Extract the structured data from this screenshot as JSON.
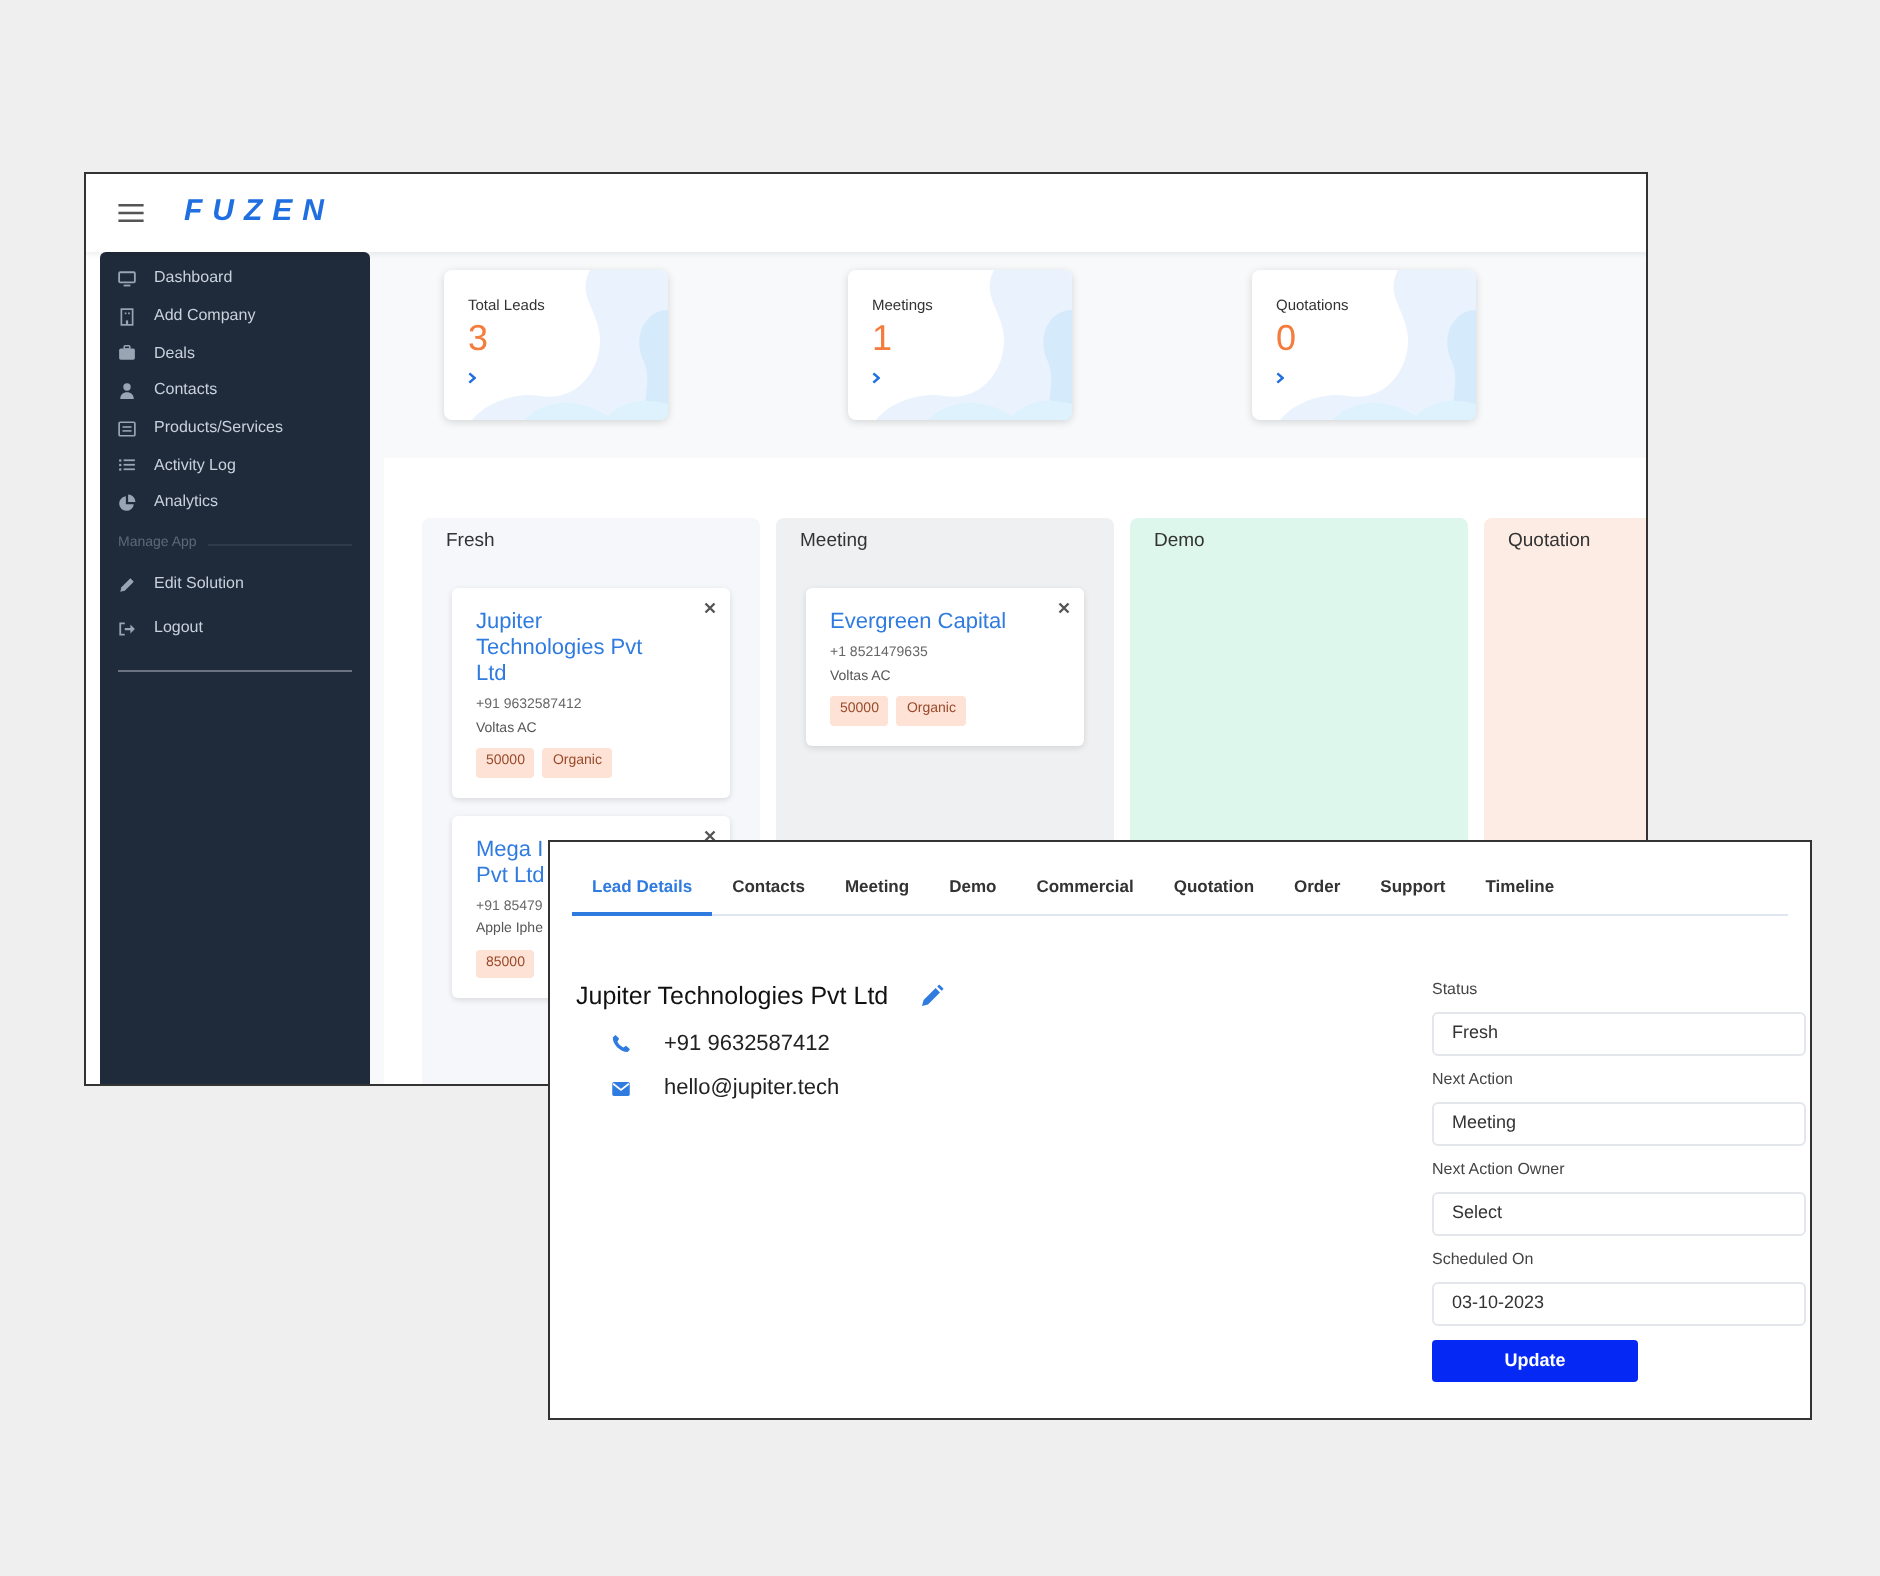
{
  "back_window": {
    "logo": "FUZEN",
    "sidebar": {
      "items": [
        {
          "label": "Dashboard",
          "kind": "monitor"
        },
        {
          "label": "Add Company",
          "kind": "building"
        },
        {
          "label": "Deals",
          "kind": "briefcase"
        },
        {
          "label": "Contacts",
          "kind": "person"
        },
        {
          "label": "Products/Services",
          "kind": "listbox"
        },
        {
          "label": "Activity Log",
          "kind": "list"
        },
        {
          "label": "Analytics",
          "kind": "pie"
        }
      ],
      "section": "Manage App",
      "app_items": [
        {
          "label": "Edit Solution",
          "kind": "pencil"
        },
        {
          "label": "Logout",
          "kind": "logout"
        }
      ]
    },
    "stats": [
      {
        "label": "Total Leads",
        "value": "3"
      },
      {
        "label": "Meetings",
        "value": "1"
      },
      {
        "label": "Quotations",
        "value": "0"
      }
    ],
    "board": {
      "columns": [
        {
          "title": "Fresh",
          "color": "#f5f7fb",
          "cards": [
            {
              "title": "Jupiter Technologies Pvt Ltd",
              "phone": "+91 9632587412",
              "product": "Voltas AC",
              "tags": [
                "50000",
                "Organic"
              ]
            },
            {
              "title": "Mega I",
              "title_2": "Pvt Ltd",
              "phone": "+91 85479",
              "product": "Apple Iphe",
              "tags": [
                "85000"
              ]
            }
          ]
        },
        {
          "title": "Meeting",
          "color": "#eef0f2",
          "cards": [
            {
              "title": "Evergreen Capital",
              "phone": "+1 8521479635",
              "product": "Voltas AC",
              "tags": [
                "50000",
                "Organic"
              ]
            }
          ]
        },
        {
          "title": "Demo",
          "color": "#ddf7ec"
        },
        {
          "title": "Quotation",
          "color": "#fdece3"
        }
      ]
    }
  },
  "front_window": {
    "tabs": [
      {
        "label": "Lead Details",
        "selected": true
      },
      {
        "label": "Contacts",
        "selected": false
      },
      {
        "label": "Meeting",
        "selected": false
      },
      {
        "label": "Demo",
        "selected": false
      },
      {
        "label": "Commercial",
        "selected": false
      },
      {
        "label": "Quotation",
        "selected": false
      },
      {
        "label": "Order",
        "selected": false
      },
      {
        "label": "Support",
        "selected": false
      },
      {
        "label": "Timeline",
        "selected": false
      }
    ],
    "lead": {
      "name": "Jupiter Technologies Pvt Ltd",
      "phone": "+91 9632587412",
      "email": "hello@jupiter.tech"
    },
    "fields": [
      {
        "label": "Status",
        "value": "Fresh"
      },
      {
        "label": "Next Action",
        "value": "Meeting"
      },
      {
        "label": "Next Action Owner",
        "value": "Select"
      },
      {
        "label": "Scheduled On",
        "value": "03-10-2023"
      }
    ],
    "button": "Update"
  }
}
